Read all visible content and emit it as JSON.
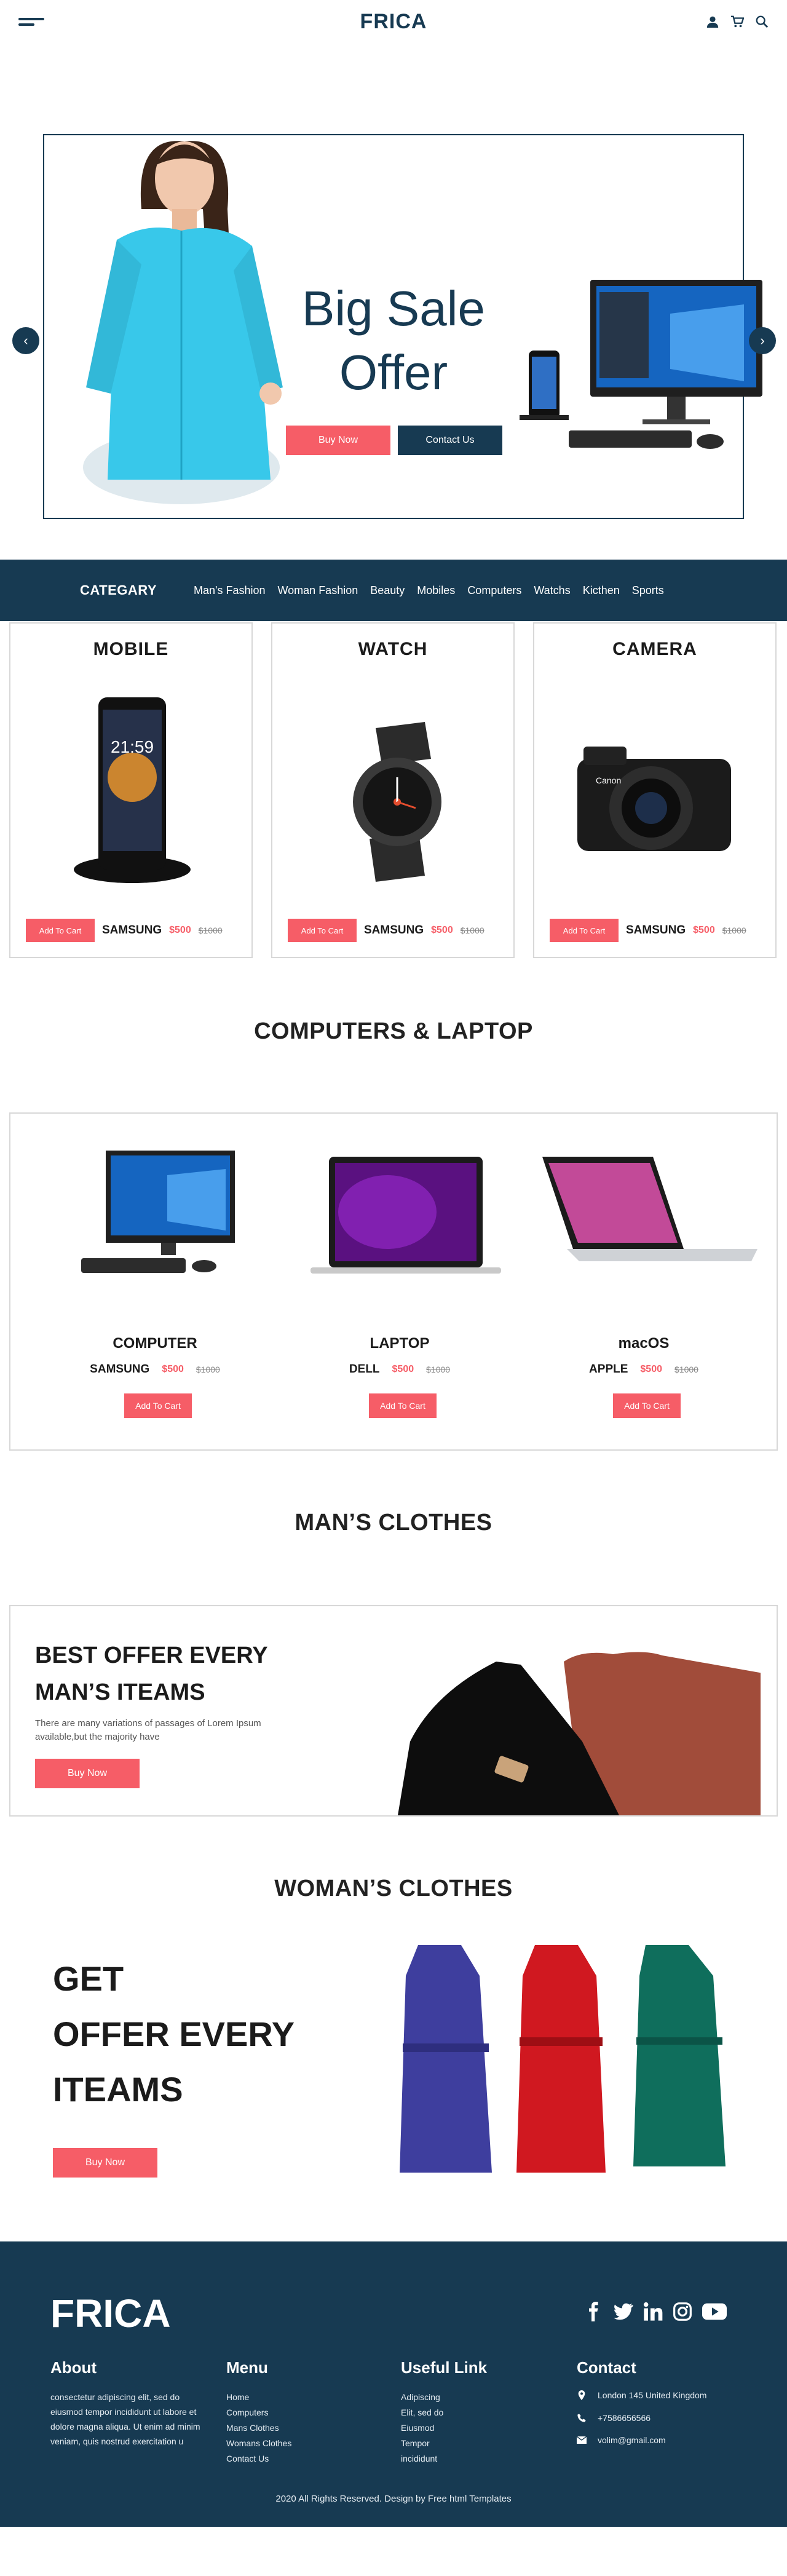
{
  "header": {
    "brand": "FRICA",
    "icons": [
      "menu-icon",
      "user-icon",
      "cart-icon",
      "search-icon"
    ]
  },
  "hero": {
    "title_line1": "Big Sale",
    "title_line2": "Offer",
    "buy_label": "Buy Now",
    "contact_label": "Contact Us"
  },
  "category_bar": {
    "title": "CATEGARY",
    "links": [
      "Man's Fashion",
      "Woman Fashion",
      "Beauty",
      "Mobiles",
      "Computers",
      "Watchs",
      "Kicthen",
      "Sports"
    ]
  },
  "products": [
    {
      "title": "MOBILE",
      "button": "Add To Cart",
      "brand": "SAMSUNG",
      "price": "$500",
      "old_price": "$1000"
    },
    {
      "title": "WATCH",
      "button": "Add To Cart",
      "brand": "SAMSUNG",
      "price": "$500",
      "old_price": "$1000"
    },
    {
      "title": "CAMERA",
      "button": "Add To Cart",
      "brand": "SAMSUNG",
      "price": "$500",
      "old_price": "$1000"
    }
  ],
  "computers": {
    "title": "COMPUTERS & LAPTOP",
    "items": [
      {
        "name": "COMPUTER",
        "brand": "SAMSUNG",
        "price": "$500",
        "old_price": "$1000",
        "button": "Add To Cart"
      },
      {
        "name": "LAPTOP",
        "brand": "DELL",
        "price": "$500",
        "old_price": "$1000",
        "button": "Add To Cart"
      },
      {
        "name": "macOS",
        "brand": "APPLE",
        "price": "$500",
        "old_price": "$1000",
        "button": "Add To Cart"
      }
    ]
  },
  "men": {
    "title": "MAN’S CLOTHES",
    "head_line1": "BEST OFFER EVERY",
    "head_line2": "MAN’S ITEAMS",
    "desc": "There are many variations of passages of Lorem Ipsum available,but the majority have",
    "button": "Buy Now"
  },
  "women": {
    "title": "WOMAN’S CLOTHES",
    "line1": "GET",
    "line2": "OFFER EVERY",
    "line3": "ITEAMS",
    "button": "Buy Now"
  },
  "footer": {
    "brand": "FRICA",
    "about_title": "About",
    "about_text": "consectetur adipiscing elit, sed do eiusmod tempor incididunt ut labore et dolore magna aliqua. Ut enim ad minim veniam, quis nostrud exercitation u",
    "menu_title": "Menu",
    "menu": [
      "Home",
      "Computers",
      "Mans Clothes",
      "Womans Clothes",
      "Contact Us"
    ],
    "useful_title": "Useful Link",
    "useful": [
      "Adipiscing",
      "Elit, sed do",
      "Eiusmod",
      "Tempor",
      "incididunt"
    ],
    "contact_title": "Contact",
    "address": "London 145 United Kingdom",
    "phone": "+7586656566",
    "email": "volim@gmail.com",
    "copyright": "2020 All Rights Reserved. Design by Free html Templates",
    "socials": [
      "facebook-icon",
      "twitter-icon",
      "linkedin-icon",
      "instagram-icon",
      "youtube-icon"
    ]
  },
  "colors": {
    "navy": "#173a52",
    "accent": "#f65d67"
  }
}
